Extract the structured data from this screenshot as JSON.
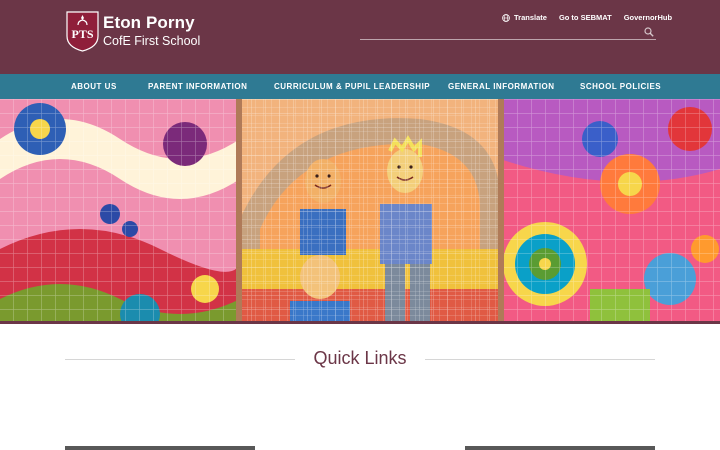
{
  "header": {
    "logo_text": "PTS",
    "school_name_line1": "Eton Porny",
    "school_name_line2": "CofE First School",
    "brand_color": "#6b3647"
  },
  "utility": {
    "translate": "Translate",
    "sebmat": "Go to SEBMAT",
    "governorhub": "GovernorHub",
    "search_placeholder": ""
  },
  "nav": {
    "color": "#2f7a93",
    "items": [
      {
        "label": "ABOUT US"
      },
      {
        "label": "PARENT INFORMATION"
      },
      {
        "label": "CURRICULUM & PUPIL LEADERSHIP"
      },
      {
        "label": "GENERAL INFORMATION"
      },
      {
        "label": "SCHOOL POLICIES"
      }
    ]
  },
  "quick_links": {
    "title": "Quick Links"
  },
  "icons": {
    "translate": "globe-icon",
    "search": "search-icon",
    "logo": "school-crest-icon"
  }
}
